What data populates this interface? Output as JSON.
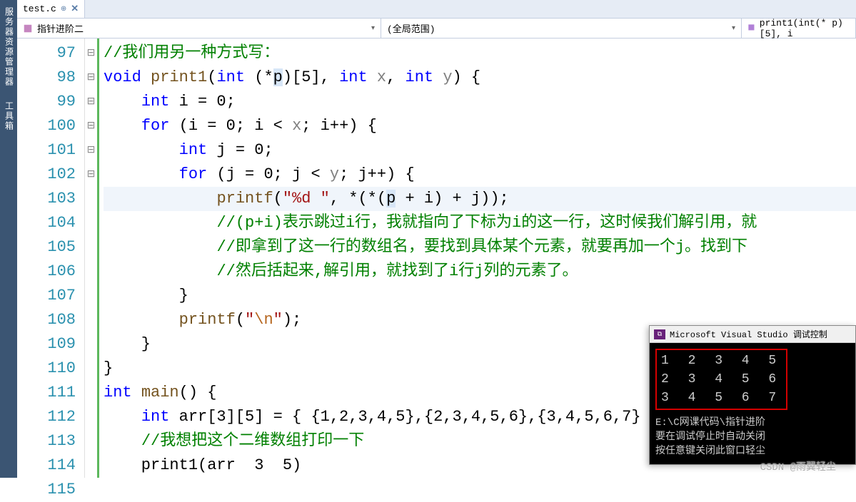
{
  "sidebar": {
    "label1": "服务器资源管理器",
    "label2": "工具箱"
  },
  "tab": {
    "filename": "test.c",
    "pin_icon": "⊕",
    "close": "✕"
  },
  "dropdowns": {
    "scope": "指针进阶二",
    "filter": "(全局范围)",
    "symbol": "print1(int(* p)[5], i"
  },
  "gutter": {
    "start": 97,
    "end": 115
  },
  "fold": [
    "",
    "",
    "⊟",
    "",
    "⊟",
    "",
    "⊟",
    "",
    "⊟",
    "",
    "",
    "",
    "",
    "",
    "",
    "⊟",
    "",
    "",
    "⊟"
  ],
  "code": {
    "lines": [
      {
        "t": "cmt",
        "text": "//我们用另一种方式写："
      },
      {
        "t": "blank",
        "text": ""
      },
      {
        "t": "sig",
        "void": "void",
        "fn": "print1",
        "params": "(int (*p)[5], int x, int y)",
        "brace": " {"
      },
      {
        "t": "decl",
        "indent": "    ",
        "type": "int",
        "rest": " i = 0;"
      },
      {
        "t": "for",
        "indent": "    ",
        "kw": "for",
        "rest": " (i = 0; i < x; i++) {"
      },
      {
        "t": "decl",
        "indent": "        ",
        "type": "int",
        "rest": " j = 0;"
      },
      {
        "t": "for",
        "indent": "        ",
        "kw": "for",
        "rest": " (j = 0; j < y; j++) {"
      },
      {
        "t": "printf",
        "indent": "            ",
        "fn": "printf",
        "str": "\"%d \"",
        "rest": ", *(*(p + i) + j));",
        "hl": true
      },
      {
        "t": "cmt2",
        "indent": "            ",
        "text": "//(p+i)表示跳过i行，我就指向了下标为i的这一行，这时候我们解引用，就"
      },
      {
        "t": "cmt2",
        "indent": "            ",
        "text": "//即拿到了这一行的数组名，要找到具体某个元素，就要再加一个j。找到下"
      },
      {
        "t": "cmt2",
        "indent": "            ",
        "text": "//然后括起来,解引用，就找到了i行j列的元素了。"
      },
      {
        "t": "plain",
        "indent": "        ",
        "text": "}"
      },
      {
        "t": "printf2",
        "indent": "        ",
        "fn": "printf",
        "str": "\"\\n\"",
        "rest": ");"
      },
      {
        "t": "plain",
        "indent": "    ",
        "text": "}"
      },
      {
        "t": "plain",
        "indent": "",
        "text": "}"
      },
      {
        "t": "main",
        "type": "int",
        "fn": "main",
        "rest": "() {"
      },
      {
        "t": "arr",
        "indent": "    ",
        "type": "int",
        "rest": " arr[3][5] = { {1,2,3,4,5},{2,3,4,5,6},{3,4,5,6,7} }"
      },
      {
        "t": "cmt2",
        "indent": "    ",
        "text": "//我想把这个二维数组打印一下"
      },
      {
        "t": "call",
        "indent": "    ",
        "text": "print1(arr  3  5)"
      }
    ]
  },
  "console": {
    "title": "Microsoft Visual Studio 调试控制",
    "output": [
      "1 2 3 4 5",
      "2 3 4 5 6",
      "3 4 5 6 7"
    ],
    "info1": "E:\\C网课代码\\指针进阶",
    "info2": "要在调试停止时自动关闭",
    "info3": "按任意键关闭此窗口轻尘"
  },
  "watermark": "CSDN @雨翼轻尘"
}
